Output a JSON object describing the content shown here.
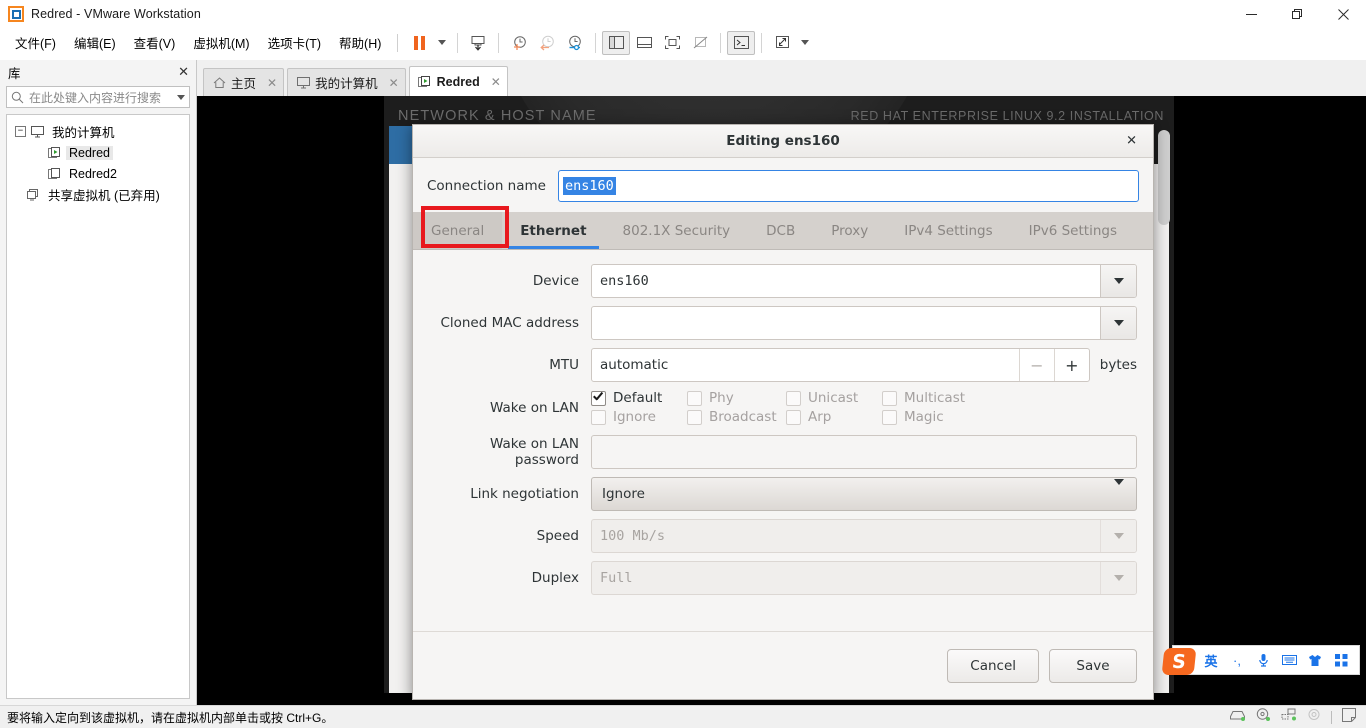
{
  "window": {
    "title": "Redred - VMware Workstation",
    "logo_icon": "vmware-logo-icon",
    "minimize_label": "minimize-icon",
    "maximize_label": "restore-icon",
    "close_label": "close-icon"
  },
  "menubar": {
    "items": [
      {
        "label": "文件(F)",
        "name": "menu-file"
      },
      {
        "label": "编辑(E)",
        "name": "menu-edit"
      },
      {
        "label": "查看(V)",
        "name": "menu-view"
      },
      {
        "label": "虚拟机(M)",
        "name": "menu-vm"
      },
      {
        "label": "选项卡(T)",
        "name": "menu-tabs"
      },
      {
        "label": "帮助(H)",
        "name": "menu-help"
      }
    ],
    "toolbar": [
      {
        "name": "pause-button",
        "icon": "pause-icon"
      },
      {
        "name": "pause-dropdown",
        "icon": "chevron-down-icon"
      },
      {
        "name": "power-options-button",
        "icon": "power-arrow-icon"
      },
      {
        "name": "take-snapshot-button",
        "icon": "snapshot-add-icon"
      },
      {
        "name": "revert-snapshot-button",
        "icon": "snapshot-revert-icon"
      },
      {
        "name": "snapshot-manager-button",
        "icon": "snapshot-manager-icon"
      },
      {
        "name": "show-library-button",
        "icon": "library-panel-icon"
      },
      {
        "name": "show-thumbnails-button",
        "icon": "thumbnail-bar-icon"
      },
      {
        "name": "fullscreen-button",
        "icon": "fullscreen-icon"
      },
      {
        "name": "unity-button",
        "icon": "unity-icon"
      },
      {
        "name": "console-button",
        "icon": "terminal-icon"
      },
      {
        "name": "stretch-button",
        "icon": "expand-arrows-icon"
      },
      {
        "name": "stretch-dropdown",
        "icon": "chevron-down-icon"
      }
    ]
  },
  "library": {
    "title": "库",
    "close_icon": "close-icon",
    "search_placeholder": "在此处键入内容进行搜索",
    "search_icon": "search-icon",
    "search_dropdown_icon": "chevron-down-icon",
    "tree": [
      {
        "label": "我的计算机",
        "level": 1,
        "icon": "monitor-icon",
        "expander": "−",
        "selected": false,
        "name": "tree-item-my-computer"
      },
      {
        "label": "Redred",
        "level": 2,
        "icon": "vm-running-icon",
        "selected": true,
        "name": "tree-item-redred"
      },
      {
        "label": "Redred2",
        "level": 2,
        "icon": "vm-icon",
        "selected": false,
        "name": "tree-item-redred2"
      },
      {
        "label": "共享虚拟机 (已弃用)",
        "level": 1.5,
        "icon": "shared-vm-icon",
        "selected": false,
        "name": "tree-item-shared-vms"
      }
    ]
  },
  "tabs": [
    {
      "label": "主页",
      "icon": "home-icon",
      "active": false,
      "name": "tab-home"
    },
    {
      "label": "我的计算机",
      "icon": "monitor-icon",
      "active": false,
      "name": "tab-my-computer"
    },
    {
      "label": "Redred",
      "icon": "vm-running-icon",
      "active": true,
      "name": "tab-redred"
    }
  ],
  "vm_screen": {
    "header_left": "NETWORK & HOST NAME",
    "header_right": "RED HAT ENTERPRISE LINUX 9.2 INSTALLATION"
  },
  "dialog": {
    "title": "Editing ens160",
    "close_icon": "close-icon",
    "connection_name_label": "Connection name",
    "connection_name_value": "ens160",
    "tabs": [
      {
        "label": "General",
        "active": false,
        "highlighted": true,
        "name": "dialog-tab-general"
      },
      {
        "label": "Ethernet",
        "active": true,
        "highlighted": false,
        "name": "dialog-tab-ethernet"
      },
      {
        "label": "802.1X Security",
        "active": false,
        "highlighted": false,
        "name": "dialog-tab-8021x-security"
      },
      {
        "label": "DCB",
        "active": false,
        "highlighted": false,
        "name": "dialog-tab-dcb"
      },
      {
        "label": "Proxy",
        "active": false,
        "highlighted": false,
        "name": "dialog-tab-proxy"
      },
      {
        "label": "IPv4 Settings",
        "active": false,
        "highlighted": false,
        "name": "dialog-tab-ipv4-settings"
      },
      {
        "label": "IPv6 Settings",
        "active": false,
        "highlighted": false,
        "name": "dialog-tab-ipv6-settings"
      }
    ],
    "fields": {
      "device_label": "Device",
      "device_value": "ens160",
      "cloned_mac_label": "Cloned MAC address",
      "cloned_mac_value": "",
      "mtu_label": "MTU",
      "mtu_value": "automatic",
      "mtu_minus": "−",
      "mtu_plus": "+",
      "mtu_units": "bytes",
      "wol_label": "Wake on LAN",
      "wol_options": [
        {
          "label": "Default",
          "checked": true,
          "enabled": true
        },
        {
          "label": "Phy",
          "checked": false,
          "enabled": false
        },
        {
          "label": "Unicast",
          "checked": false,
          "enabled": false
        },
        {
          "label": "Multicast",
          "checked": false,
          "enabled": false
        },
        {
          "label": "Ignore",
          "checked": false,
          "enabled": false
        },
        {
          "label": "Broadcast",
          "checked": false,
          "enabled": false
        },
        {
          "label": "Arp",
          "checked": false,
          "enabled": false
        },
        {
          "label": "Magic",
          "checked": false,
          "enabled": false
        }
      ],
      "wol_password_label": "Wake on LAN password",
      "wol_password_value": "",
      "link_negotiation_label": "Link negotiation",
      "link_negotiation_value": "Ignore",
      "speed_label": "Speed",
      "speed_value": "100 Mb/s",
      "duplex_label": "Duplex",
      "duplex_value": "Full"
    },
    "cancel_label": "Cancel",
    "save_label": "Save",
    "highlight_color": "#e8191e",
    "accent_color": "#3584e4"
  },
  "statusbar": {
    "text": "要将输入定向到该虚拟机，请在虚拟机内部单击或按 Ctrl+G。",
    "icons": [
      {
        "name": "hard-disk-status-icon"
      },
      {
        "name": "cd-drive-status-icon"
      },
      {
        "name": "network-status-icon"
      },
      {
        "name": "usb-status-icon"
      },
      {
        "name": "message-log-icon"
      }
    ]
  },
  "ime": {
    "logo": "S",
    "items": [
      {
        "label": "英",
        "name": "ime-language-toggle"
      },
      {
        "label": "·,",
        "name": "ime-punctuation-toggle"
      },
      {
        "label": "mic",
        "name": "ime-voice-input"
      },
      {
        "label": "kbd",
        "name": "ime-soft-keyboard"
      },
      {
        "label": "skin",
        "name": "ime-skin"
      },
      {
        "label": "apps",
        "name": "ime-toolbox"
      }
    ]
  }
}
